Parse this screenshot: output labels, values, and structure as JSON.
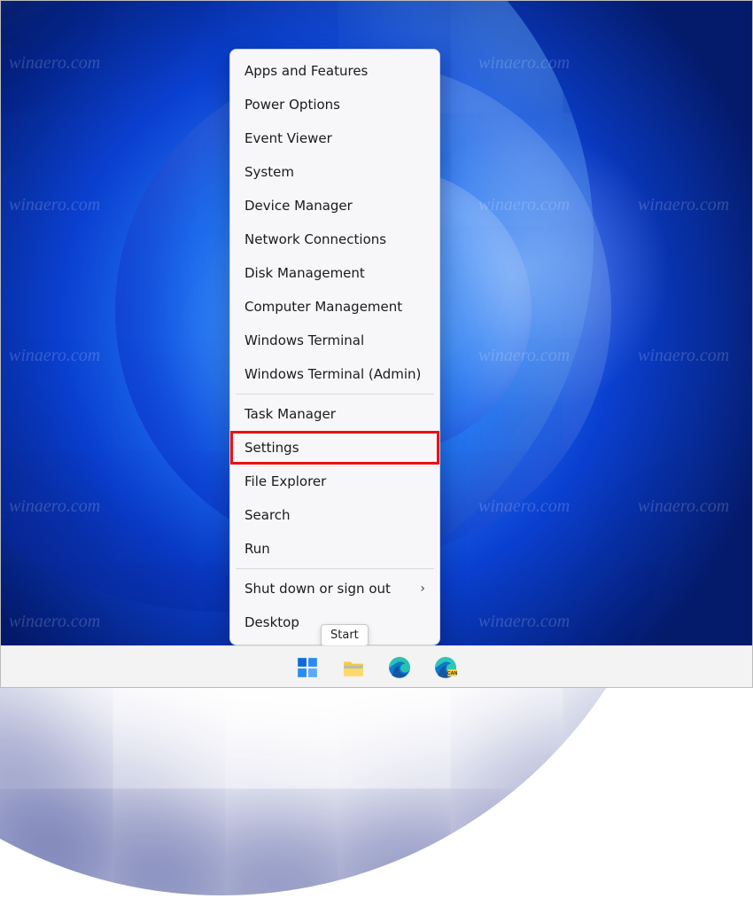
{
  "watermark": "winaero.com",
  "menu": {
    "items": [
      {
        "label": "Apps and Features"
      },
      {
        "label": "Power Options"
      },
      {
        "label": "Event Viewer"
      },
      {
        "label": "System"
      },
      {
        "label": "Device Manager"
      },
      {
        "label": "Network Connections"
      },
      {
        "label": "Disk Management"
      },
      {
        "label": "Computer Management"
      },
      {
        "label": "Windows Terminal"
      },
      {
        "label": "Windows Terminal (Admin)"
      }
    ],
    "items2": [
      {
        "label": "Task Manager"
      },
      {
        "label": "Settings"
      },
      {
        "label": "File Explorer"
      },
      {
        "label": "Search"
      },
      {
        "label": "Run"
      }
    ],
    "items3": [
      {
        "label": "Shut down or sign out",
        "submenu": true
      },
      {
        "label": "Desktop"
      }
    ]
  },
  "tooltip": "Start",
  "taskbar": {
    "start": "Start",
    "explorer": "File Explorer",
    "edge": "Microsoft Edge",
    "edge_can": "Microsoft Edge Canary"
  },
  "highlight_item": "Settings"
}
